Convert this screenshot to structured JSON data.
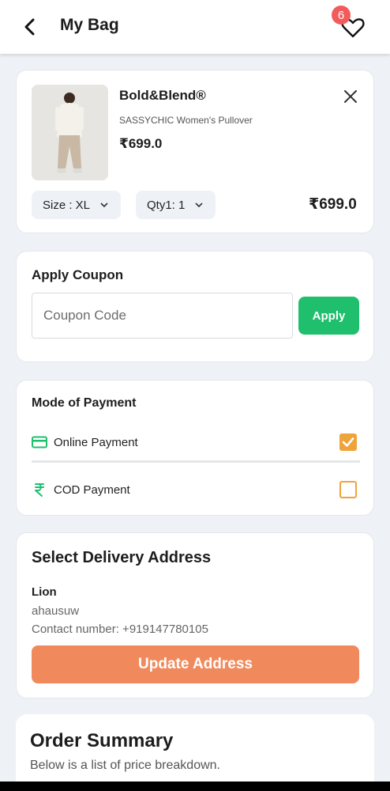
{
  "header": {
    "title": "My Bag",
    "wishlist_count": "6",
    "back_icon": "chevron-left-icon",
    "wishlist_icon": "heart-icon"
  },
  "product": {
    "brand": "Bold&Blend®",
    "name": "SASSYCHIC Women's Pullover",
    "price": "₹699.0",
    "size_label": "Size : XL",
    "qty_label": "Qty1: 1",
    "total": "₹699.0"
  },
  "coupon": {
    "title": "Apply Coupon",
    "placeholder": "Coupon Code",
    "value": "",
    "apply_label": "Apply"
  },
  "payment": {
    "title": "Mode of Payment",
    "options": [
      {
        "label": "Online Payment",
        "icon": "credit-card-icon",
        "checked": true
      },
      {
        "label": "COD Payment",
        "icon": "rupee-icon",
        "checked": false
      }
    ]
  },
  "address": {
    "title": "Select Delivery Address",
    "name": "Lion",
    "line": "ahausuw",
    "contact": "Contact number: +919147780105",
    "update_label": "Update Address"
  },
  "summary": {
    "title": "Order Summary",
    "subtitle": "Below is a list of price breakdown."
  },
  "colors": {
    "accent_green": "#1fbf6e",
    "accent_orange": "#f08a5d",
    "checkbox_orange": "#f0a33b",
    "badge_red": "#f15b5b"
  }
}
